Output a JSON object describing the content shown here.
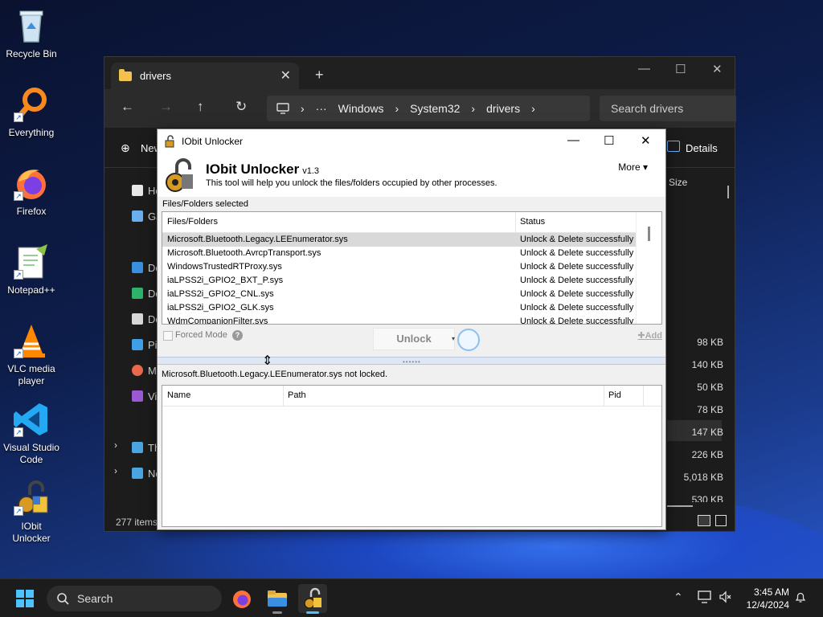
{
  "desktop": {
    "icons": [
      {
        "label": "Recycle Bin"
      },
      {
        "label": "Everything"
      },
      {
        "label": "Firefox"
      },
      {
        "label": "Notepad++"
      },
      {
        "label": "VLC media player"
      },
      {
        "label": "Visual Studio Code"
      },
      {
        "label": "IObit Unlocker"
      }
    ]
  },
  "explorer": {
    "tab_title": "drivers",
    "breadcrumb": [
      "Windows",
      "System32",
      "drivers"
    ],
    "breadcrumb_ellipsis": "···",
    "search_placeholder": "Search drivers",
    "cmd_new": "New",
    "cmd_details": "Details",
    "column_size": "Size",
    "sidebar": [
      "Ho",
      "Ga",
      "De",
      "Do",
      "Do",
      "Pi",
      "M",
      "Vi",
      "Th",
      "Ne"
    ],
    "sizes": [
      "98 KB",
      "140 KB",
      "50 KB",
      "78 KB",
      "147 KB",
      "226 KB",
      "5,018 KB",
      "530 KB"
    ],
    "status_items": "277 items"
  },
  "iobit": {
    "window_title": "IObit Unlocker",
    "app_name": "IObit Unlocker",
    "version": "v1.3",
    "description": "This tool will help you unlock the files/folders occupied by other processes.",
    "more_label": "More",
    "files_section_label": "Files/Folders selected",
    "files_columns": [
      "Files/Folders",
      "Status"
    ],
    "files": [
      {
        "name": "Microsoft.Bluetooth.Legacy.LEEnumerator.sys",
        "status": "Unlock & Delete successfully"
      },
      {
        "name": "Microsoft.Bluetooth.AvrcpTransport.sys",
        "status": "Unlock & Delete successfully"
      },
      {
        "name": "WindowsTrustedRTProxy.sys",
        "status": "Unlock & Delete successfully"
      },
      {
        "name": "iaLPSS2i_GPIO2_BXT_P.sys",
        "status": "Unlock & Delete successfully"
      },
      {
        "name": "iaLPSS2i_GPIO2_CNL.sys",
        "status": "Unlock & Delete successfully"
      },
      {
        "name": "iaLPSS2i_GPIO2_GLK.sys",
        "status": "Unlock & Delete successfully"
      },
      {
        "name": "WdmCompanionFilter.sys",
        "status": "Unlock & Delete successfully"
      }
    ],
    "forced_mode_label": "Forced Mode",
    "help_glyph": "?",
    "unlock_label": "Unlock",
    "add_label": "Add",
    "lock_status": "Microsoft.Bluetooth.Legacy.LEEnumerator.sys not locked.",
    "process_columns": [
      "Name",
      "Path",
      "Pid"
    ]
  },
  "taskbar": {
    "search_label": "Search",
    "time": "3:45 AM",
    "date": "12/4/2024"
  },
  "colors": {
    "accent": "#4cc2ff",
    "folder": "#f2c14e",
    "selected_row": "#d9d9d9"
  }
}
